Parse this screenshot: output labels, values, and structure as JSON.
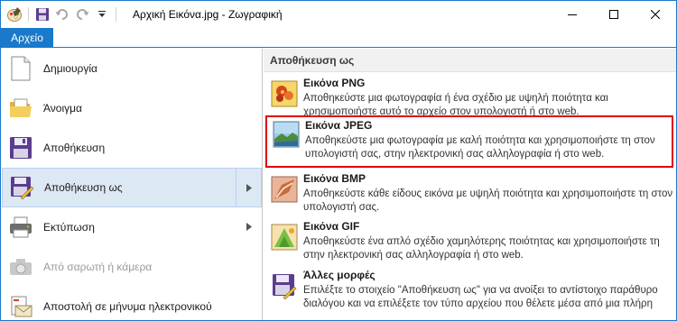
{
  "window": {
    "title": "Αρχική Εικόνα.jpg - Ζωγραφική",
    "accent_color": "#1979ca",
    "highlight_color": "#e00000"
  },
  "qat": {
    "app_icon": "paint-palette-icon",
    "save_icon": "floppy-icon",
    "undo_icon": "undo-icon",
    "redo_icon": "redo-icon",
    "customize_icon": "dropdown-arrow-icon"
  },
  "ribbon": {
    "file_tab_label": "Αρχείο"
  },
  "file_menu": {
    "items": [
      {
        "label": "Δημιουργία",
        "icon": "new-document-icon"
      },
      {
        "label": "Άνοιγμα",
        "icon": "folder-open-icon"
      },
      {
        "label": "Αποθήκευση",
        "icon": "floppy-icon"
      },
      {
        "label": "Αποθήκευση ως",
        "icon": "save-as-icon"
      },
      {
        "label": "Εκτύπωση",
        "icon": "printer-icon"
      },
      {
        "label": "Από σαρωτή ή κάμερα",
        "icon": "camera-icon"
      },
      {
        "label": "Αποστολή σε μήνυμα ηλεκτρονικού",
        "icon": "email-icon"
      }
    ]
  },
  "save_as_panel": {
    "heading": "Αποθήκευση ως",
    "formats": [
      {
        "title": "Εικόνα PNG",
        "description": "Αποθηκεύστε μια φωτογραφία ή ένα σχέδιο με υψηλή ποιότητα και χρησιμοποιήστε αυτό το αρχείο στον υπολογιστή ή στο web.",
        "icon": "png-image-icon"
      },
      {
        "title": "Εικόνα JPEG",
        "description": "Αποθηκεύστε μια φωτογραφία με καλή ποιότητα και χρησιμοποιήστε τη στον υπολογιστή σας, στην ηλεκτρονική σας αλληλογραφία ή στο web.",
        "icon": "jpeg-image-icon"
      },
      {
        "title": "Εικόνα BMP",
        "description": "Αποθηκεύστε κάθε είδους εικόνα με υψηλή ποιότητα και χρησιμοποιήστε τη στον υπολογιστή σας.",
        "icon": "bmp-image-icon"
      },
      {
        "title": "Εικόνα GIF",
        "description": "Αποθηκεύστε ένα απλό σχέδιο χαμηλότερης ποιότητας και χρησιμοποιήστε τη στην ηλεκτρονική σας αλληλογραφία ή στο web.",
        "icon": "gif-image-icon"
      },
      {
        "title": "Άλλες μορφές",
        "description": "Επιλέξτε το στοιχείο \"Αποθήκευση ως\" για να ανοίξει το αντίστοιχο παράθυρο διαλόγου και να επιλέξετε τον τύπο αρχείου που θέλετε μέσα από μια πλήρη",
        "icon": "other-formats-icon"
      }
    ]
  }
}
